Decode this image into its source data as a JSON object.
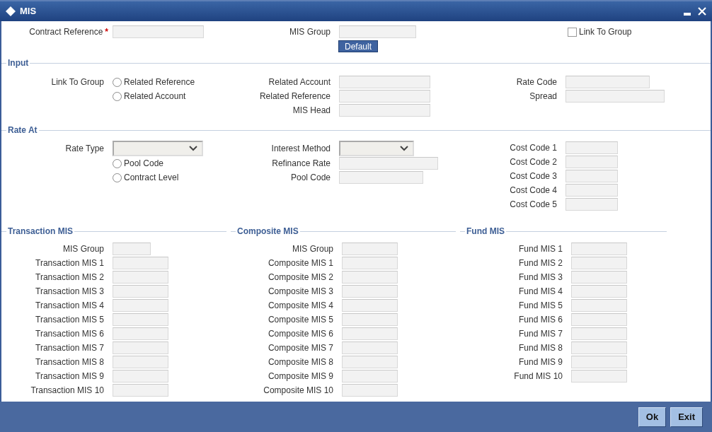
{
  "window": {
    "title": "MIS"
  },
  "header": {
    "contract_reference": {
      "label": "Contract Reference",
      "required_marker": "*"
    },
    "mis_group": {
      "label": "MIS Group"
    },
    "default_button": "Default",
    "link_to_group": {
      "label": "Link To Group",
      "checked": false
    }
  },
  "input": {
    "title": "Input",
    "link_label": "Link To Group",
    "options": [
      {
        "label": "Related Reference",
        "selected": false
      },
      {
        "label": "Related Account",
        "selected": false
      }
    ],
    "fields": [
      {
        "label": "Related Account"
      },
      {
        "label": "Related Reference"
      },
      {
        "label": "MIS Head"
      }
    ],
    "rate_fields": [
      {
        "label": "Rate Code"
      },
      {
        "label": "Spread"
      }
    ]
  },
  "rate_at": {
    "title": "Rate At",
    "rate_type": {
      "label": "Rate Type"
    },
    "options": [
      {
        "label": "Pool Code",
        "selected": false
      },
      {
        "label": "Contract Level",
        "selected": false
      }
    ],
    "fields": [
      {
        "label": "Interest Method",
        "kind": "select"
      },
      {
        "label": "Refinance Rate",
        "kind": "text"
      },
      {
        "label": "Pool Code",
        "kind": "text"
      }
    ],
    "cost_codes": [
      {
        "label": "Cost Code 1"
      },
      {
        "label": "Cost Code 2"
      },
      {
        "label": "Cost Code 3"
      },
      {
        "label": "Cost Code 4"
      },
      {
        "label": "Cost Code 5"
      }
    ]
  },
  "mis_sections": [
    {
      "title": "Transaction MIS",
      "fields": [
        {
          "label": "MIS Group"
        },
        {
          "label": "Transaction MIS 1"
        },
        {
          "label": "Transaction MIS 2"
        },
        {
          "label": "Transaction MIS 3"
        },
        {
          "label": "Transaction MIS 4"
        },
        {
          "label": "Transaction MIS 5"
        },
        {
          "label": "Transaction MIS 6"
        },
        {
          "label": "Transaction MIS 7"
        },
        {
          "label": "Transaction MIS 8"
        },
        {
          "label": "Transaction MIS 9"
        },
        {
          "label": "Transaction MIS 10"
        }
      ]
    },
    {
      "title": "Composite MIS",
      "fields": [
        {
          "label": "MIS Group"
        },
        {
          "label": "Composite MIS 1"
        },
        {
          "label": "Composite MIS 2"
        },
        {
          "label": "Composite MIS 3"
        },
        {
          "label": "Composite MIS 4"
        },
        {
          "label": "Composite MIS 5"
        },
        {
          "label": "Composite MIS 6"
        },
        {
          "label": "Composite MIS 7"
        },
        {
          "label": "Composite MIS 8"
        },
        {
          "label": "Composite MIS 9"
        },
        {
          "label": "Composite MIS 10"
        }
      ]
    },
    {
      "title": "Fund MIS",
      "fields": [
        {
          "label": "Fund MIS 1"
        },
        {
          "label": "Fund MIS 2"
        },
        {
          "label": "Fund MIS 3"
        },
        {
          "label": "Fund MIS 4"
        },
        {
          "label": "Fund MIS 5"
        },
        {
          "label": "Fund MIS 6"
        },
        {
          "label": "Fund MIS 7"
        },
        {
          "label": "Fund MIS 8"
        },
        {
          "label": "Fund MIS 9"
        },
        {
          "label": "Fund MIS 10"
        }
      ]
    }
  ],
  "buttons": [
    "Ok",
    "Exit"
  ]
}
